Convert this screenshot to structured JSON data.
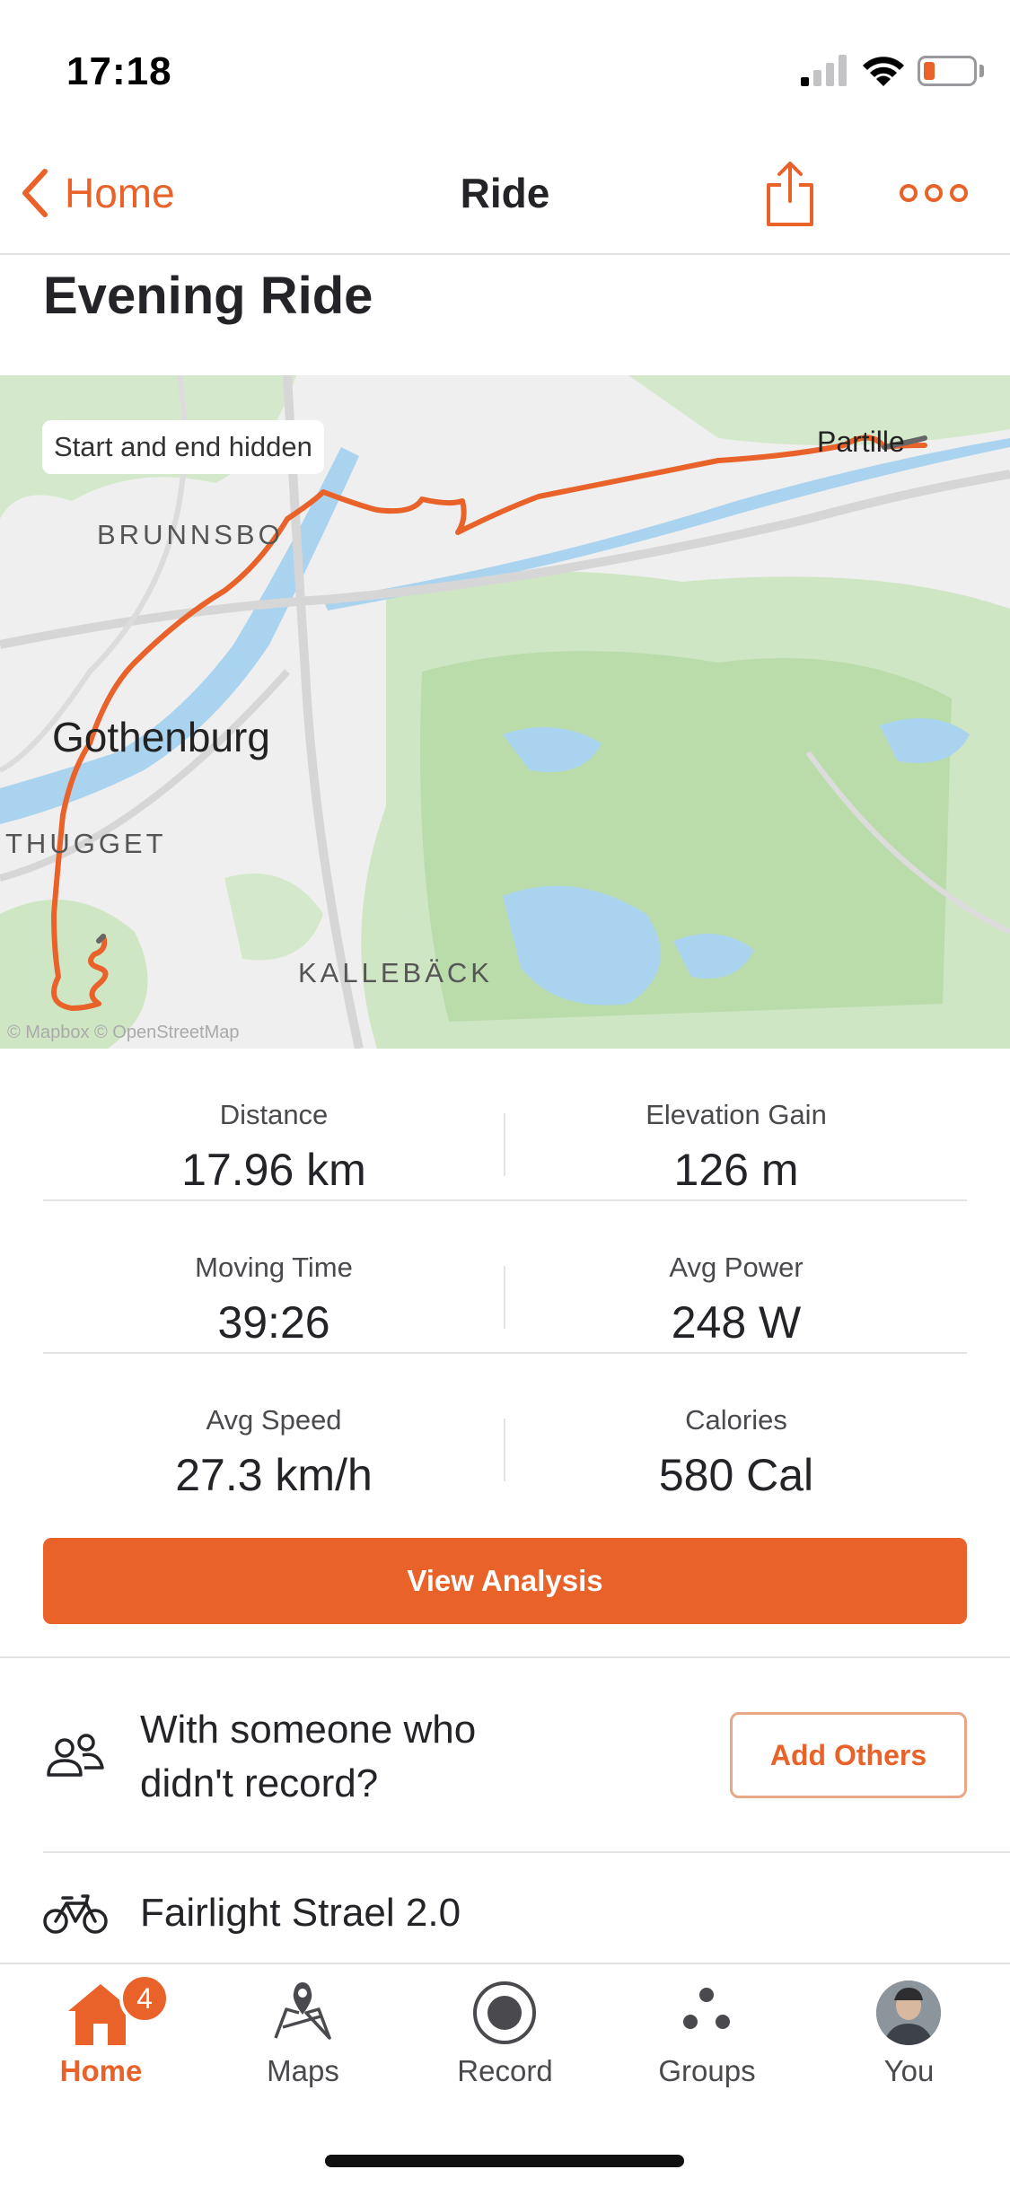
{
  "status_bar": {
    "time": "17:18"
  },
  "nav": {
    "back_label": "Home",
    "title": "Ride"
  },
  "activity": {
    "title": "Evening Ride"
  },
  "map": {
    "privacy_label": "Start and end hidden",
    "places": {
      "brunnsbo": "BRUNNSBO",
      "gothenburg": "Gothenburg",
      "thorildsplan": "THUGGET",
      "kalleback": "KALLEBÄCK",
      "partille": "Partille"
    },
    "attribution": "© Mapbox © OpenStreetMap"
  },
  "stats": [
    [
      {
        "label": "Distance",
        "value": "17.96 km"
      },
      {
        "label": "Elevation Gain",
        "value": "126 m"
      }
    ],
    [
      {
        "label": "Moving Time",
        "value": "39:26"
      },
      {
        "label": "Avg Power",
        "value": "248 W"
      }
    ],
    [
      {
        "label": "Avg Speed",
        "value": "27.3 km/h"
      },
      {
        "label": "Calories",
        "value": "580 Cal"
      }
    ]
  ],
  "view_analysis_label": "View Analysis",
  "with_others": {
    "text": "With someone who didn't record?",
    "button_label": "Add Others"
  },
  "gear": {
    "name": "Fairlight Strael 2.0"
  },
  "tabs": [
    {
      "label": "Home",
      "icon": "home-icon",
      "badge": "4",
      "active": true
    },
    {
      "label": "Maps",
      "icon": "maps-icon"
    },
    {
      "label": "Record",
      "icon": "record-icon"
    },
    {
      "label": "Groups",
      "icon": "groups-icon"
    },
    {
      "label": "You",
      "icon": "avatar"
    }
  ],
  "colors": {
    "accent": "#e8622a",
    "route": "#e8622a",
    "text": "#242428",
    "divider": "#e3e3e3"
  }
}
